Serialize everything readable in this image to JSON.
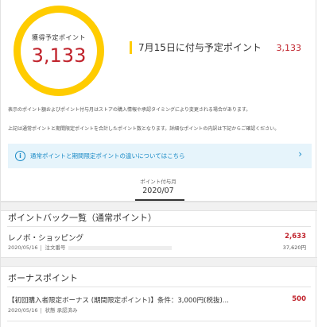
{
  "summary": {
    "ring_label": "獲得予定ポイント",
    "ring_value": "3,133",
    "scheduled_label": "7月15日に付与予定ポイント",
    "scheduled_value": "3,133"
  },
  "notes": {
    "line1": "表示のポイント額およびポイント付与月はストアの購入情報や承認タイミングにより変更される場合があります。",
    "line2": "上記は通常ポイントと期間限定ポイントを合計したポイント数となります。詳細なポイントの内訳は下記からご確認ください。"
  },
  "info_banner": {
    "icon": "info-icon",
    "text": "通常ポイントと期間限定ポイントの違いについてはこちら",
    "chevron": "›"
  },
  "month_tab": {
    "label": "ポイント付与月",
    "value": "2020/07"
  },
  "pointback": {
    "title": "ポイントバック一覧（通常ポイント）",
    "items": [
      {
        "name": "レノボ・ショッピング",
        "points": "2,633",
        "date": "2020/05/16",
        "meta_label": "注文番号",
        "amount": "37,620円"
      }
    ]
  },
  "bonus": {
    "title": "ボーナスポイント",
    "items": [
      {
        "name": "【初回購入者限定ボーナス (期間限定ポイント)】条件：3,000円(税抜)...",
        "points": "500",
        "date": "2020/05/16",
        "status_label": "状態",
        "status_value": "承認済み"
      }
    ]
  },
  "colors": {
    "accent_yellow": "#ffcc00",
    "point_red": "#c0232c",
    "link_blue": "#1a8ac6",
    "info_bg": "#e6f4fb"
  }
}
